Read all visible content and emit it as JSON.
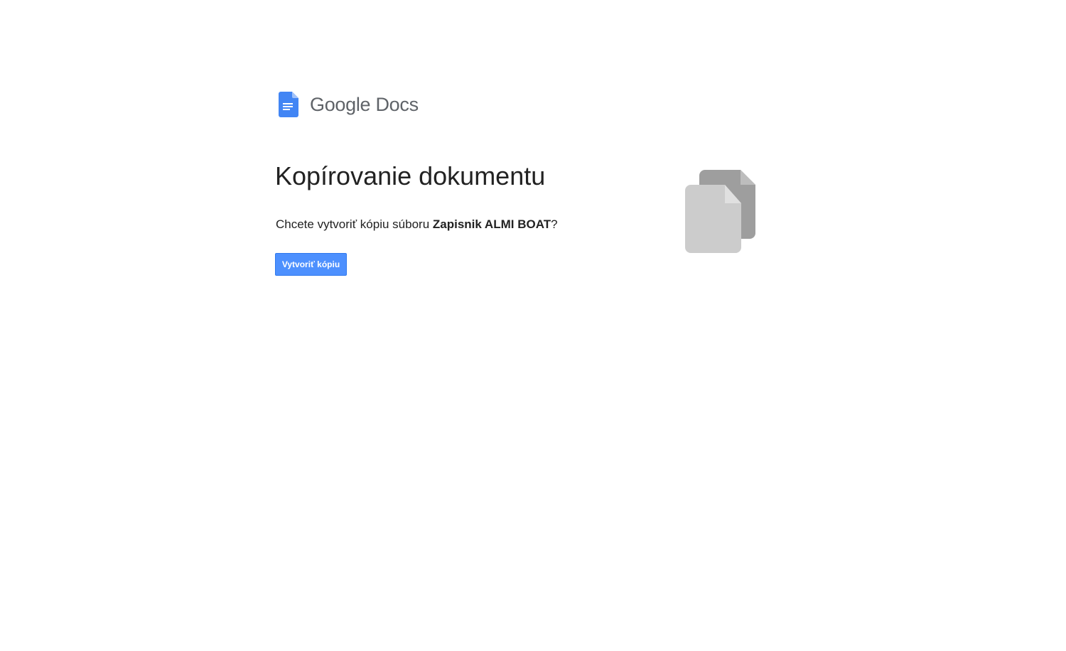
{
  "brand": {
    "logo_icon": "google-docs-icon",
    "name": "Google Docs",
    "accent_color": "#4285f4"
  },
  "dialog": {
    "title": "Kopírovanie dokumentu",
    "question_prefix": "Chcete vytvoriť kópiu súboru ",
    "file_name": "Zapisnik ALMI BOAT",
    "question_suffix": "?",
    "button_label": "Vytvoriť kópiu",
    "button_color": "#4d90fe",
    "illustration_icon": "copy-documents-icon"
  }
}
